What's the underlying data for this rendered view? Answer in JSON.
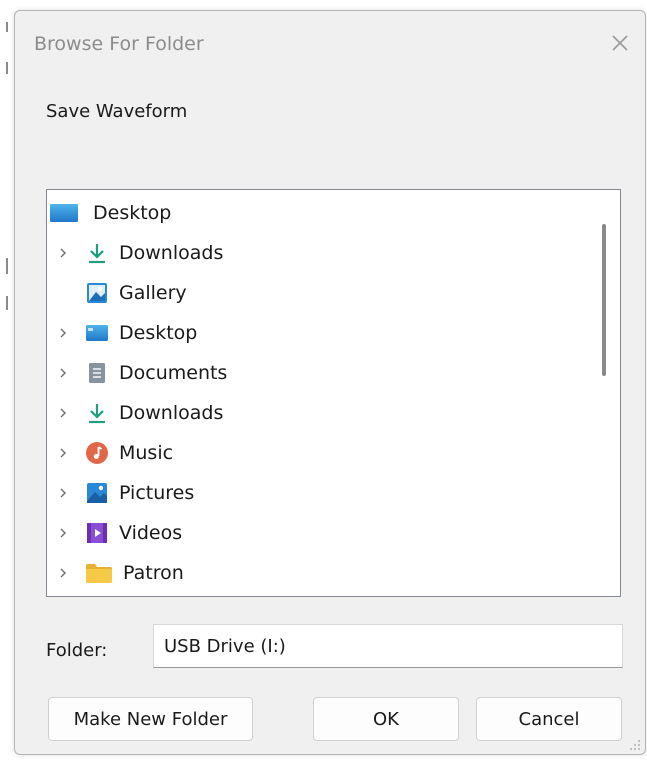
{
  "dialog": {
    "title": "Browse For Folder",
    "prompt": "Save Waveform"
  },
  "tree": {
    "items": [
      {
        "label": "Desktop",
        "icon": "desktop-icon",
        "expandable": false,
        "indent": 0
      },
      {
        "label": "Downloads",
        "icon": "download-arrow-icon",
        "expandable": true,
        "indent": 1
      },
      {
        "label": "Gallery",
        "icon": "gallery-icon",
        "expandable": false,
        "indent": 1
      },
      {
        "label": "Desktop",
        "icon": "desktop-icon",
        "expandable": true,
        "indent": 1
      },
      {
        "label": "Documents",
        "icon": "document-icon",
        "expandable": true,
        "indent": 1
      },
      {
        "label": "Downloads",
        "icon": "download-arrow-icon",
        "expandable": true,
        "indent": 1
      },
      {
        "label": "Music",
        "icon": "music-icon",
        "expandable": true,
        "indent": 1
      },
      {
        "label": "Pictures",
        "icon": "pictures-icon",
        "expandable": true,
        "indent": 1
      },
      {
        "label": "Videos",
        "icon": "videos-icon",
        "expandable": true,
        "indent": 1
      },
      {
        "label": "Patron",
        "icon": "folder-icon",
        "expandable": true,
        "indent": 1
      }
    ]
  },
  "folder": {
    "label": "Folder:",
    "value": "USB Drive (I:)"
  },
  "buttons": {
    "make_new_folder": "Make New Folder",
    "ok": "OK",
    "cancel": "Cancel"
  },
  "colors": {
    "dialog_bg": "#f0f0f0",
    "tree_border": "#828790",
    "download_green": "#1e9e7e",
    "desktop_blue": "#2b88d8",
    "music_orange": "#e0674a",
    "videos_purple": "#8b4cd6",
    "folder_yellow": "#f5c542"
  }
}
